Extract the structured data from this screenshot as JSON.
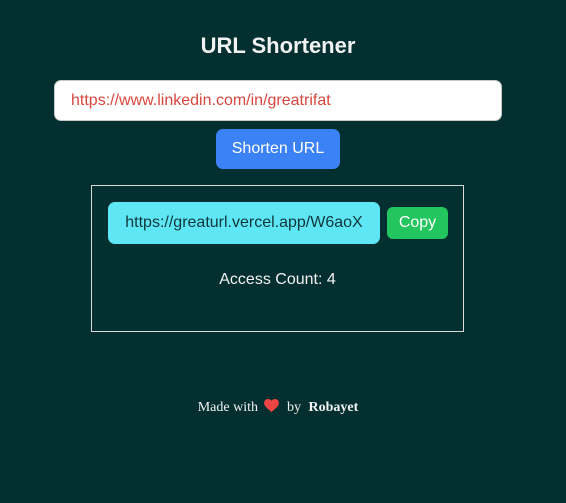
{
  "app": {
    "title": "URL Shortener"
  },
  "form": {
    "url_value": "https://www.linkedin.com/in/greatrifat",
    "shorten_label": "Shorten URL"
  },
  "result": {
    "short_url": "https://greaturl.vercel.app/W6aoX",
    "copy_label": "Copy",
    "access_count_text": "Access Count: 4"
  },
  "footer": {
    "made_with": "Made with",
    "by": "by",
    "author": "Robayet",
    "heart_icon": "heart-icon",
    "heart_color": "#ef4444"
  },
  "colors": {
    "background": "#032f30",
    "input_text": "#d9463e",
    "shorten_button": "#3b82f6",
    "short_link_bg": "#5ee6f5",
    "copy_button": "#22c55e"
  }
}
